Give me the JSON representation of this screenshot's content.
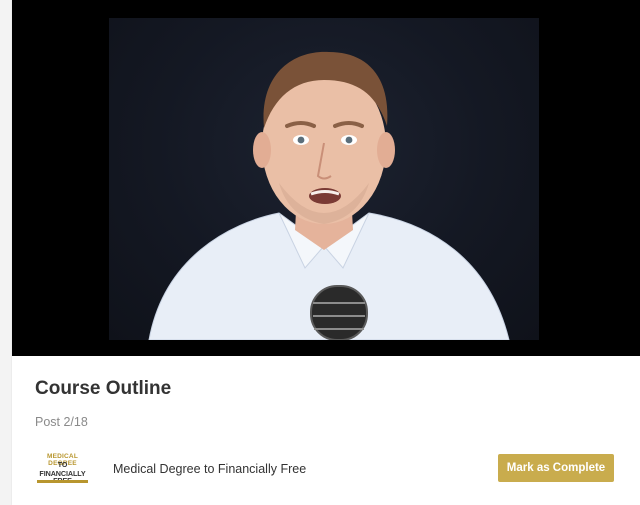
{
  "video": {
    "player_label": "video-player"
  },
  "outline": {
    "title": "Course Outline",
    "post_count": "Post 2/18",
    "course": {
      "logo": {
        "line1": "MEDICAL DEGREE",
        "line2": "TO",
        "line3": "FINANCIALLY FREE"
      },
      "name": "Medical Degree to Financially Free"
    },
    "mark_complete_label": "Mark as Complete"
  },
  "colors": {
    "accent": "#c9ac4d",
    "video_bg": "#000000",
    "title_text": "#333333",
    "muted_text": "#8a8a8a"
  }
}
